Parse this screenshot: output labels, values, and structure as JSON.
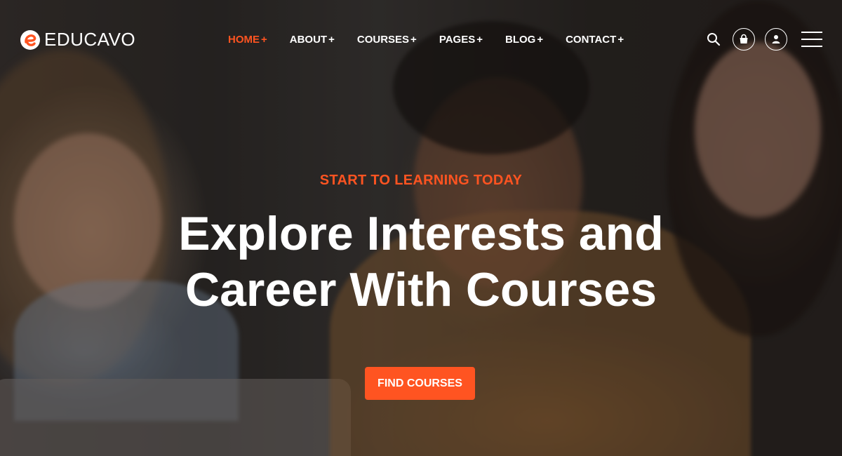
{
  "brand": {
    "name": "EDUCAVO",
    "accent": "#ff5421"
  },
  "nav": {
    "items": [
      {
        "label": "HOME",
        "suffix": "+",
        "active": true
      },
      {
        "label": "ABOUT",
        "suffix": "+"
      },
      {
        "label": "COURSES",
        "suffix": "+"
      },
      {
        "label": "PAGES",
        "suffix": "+"
      },
      {
        "label": "BLOG",
        "suffix": "+"
      },
      {
        "label": "CONTACT",
        "suffix": "+"
      }
    ]
  },
  "header_icons": [
    "search-icon",
    "cart-icon",
    "user-icon",
    "menu-icon"
  ],
  "hero": {
    "eyebrow": "START TO LEARNING TODAY",
    "headline_line1": "Explore Interests and",
    "headline_line2": "Career With Courses",
    "cta_label": "FIND COURSES"
  }
}
